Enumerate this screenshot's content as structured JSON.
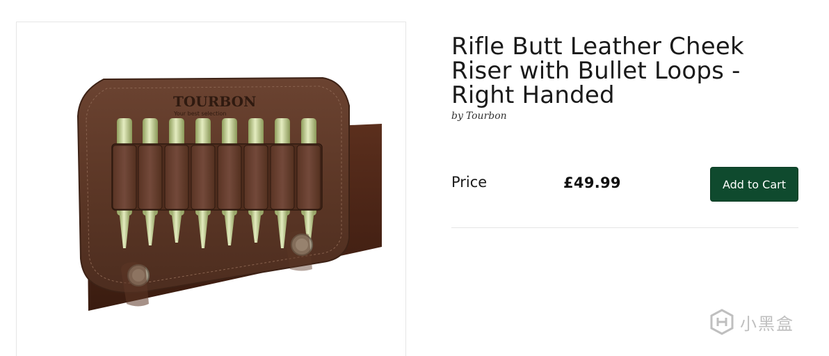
{
  "product": {
    "title": "Rifle Butt Leather Cheek Riser with Bullet Loops - Right Handed",
    "by_label": "by",
    "brand": "Tourbon",
    "image": {
      "brand_print": "TOURBON",
      "slogan_print": "Your best selection"
    }
  },
  "pricing": {
    "price_label": "Price",
    "price_value": "£49.99",
    "add_to_cart_label": "Add to Cart"
  },
  "watermark": {
    "text": "小黑盒"
  },
  "colors": {
    "button_bg": "#0f4a2e",
    "leather": "#5a3322",
    "bullet": "#b9c98a"
  }
}
